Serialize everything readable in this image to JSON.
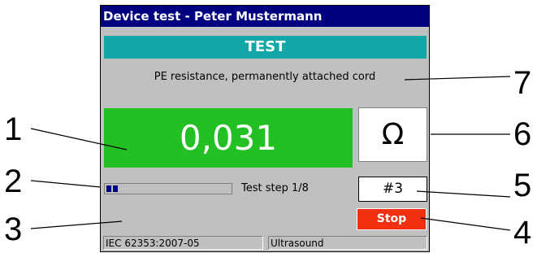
{
  "window": {
    "title": "Device test - Peter Mustermann"
  },
  "banner": {
    "label": "TEST",
    "color": "#12a6a6"
  },
  "test": {
    "name": "PE resistance, permanently attached cord"
  },
  "measurement": {
    "value": "0,031",
    "unit": "Ω",
    "status_color": "#22c022"
  },
  "progress": {
    "current_step": 1,
    "total_steps": 8,
    "label": "Test step 1/8"
  },
  "step_number": "#3",
  "stop_button": {
    "label": "Stop",
    "color": "#f03010"
  },
  "status_bar": {
    "standard": "IEC 62353:2007-05",
    "mode": "Ultrasound"
  },
  "callouts": [
    "1",
    "2",
    "3",
    "4",
    "5",
    "6",
    "7"
  ]
}
